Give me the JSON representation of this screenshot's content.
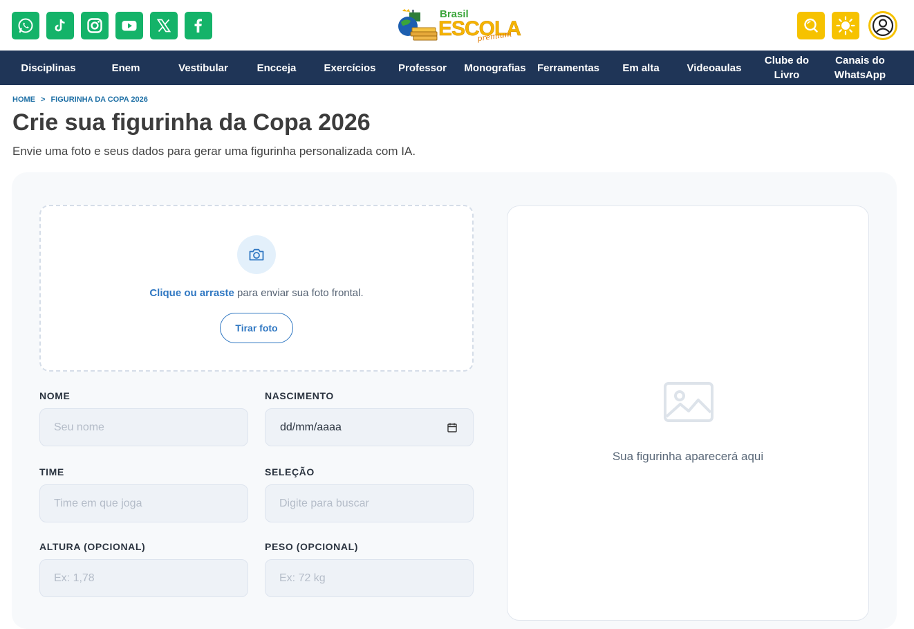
{
  "header": {
    "social_icons": [
      "whatsapp-icon",
      "tiktok-icon",
      "instagram-icon",
      "youtube-icon",
      "x-icon",
      "facebook-icon"
    ],
    "logo": {
      "brand_top": "Brasil",
      "brand_main": "ESCOLA",
      "brand_tag": "premium"
    },
    "action_icons": [
      "search-icon",
      "theme-toggle-icon",
      "user-icon"
    ],
    "accent_color": "#f6c200",
    "social_color": "#14b369"
  },
  "nav": {
    "items": [
      "Disciplinas",
      "Enem",
      "Vestibular",
      "Encceja",
      "Exercícios",
      "Professor",
      "Monografias",
      "Ferramentas",
      "Em alta",
      "Videoaulas",
      "Clube do Livro",
      "Canais do WhatsApp"
    ],
    "background": "#1f3557"
  },
  "breadcrumb": {
    "home": "HOME",
    "separator": ">",
    "current": "FIGURINHA DA COPA 2026"
  },
  "page": {
    "title": "Crie sua figurinha da Copa 2026",
    "subtitle": "Envie uma foto e seus dados para gerar uma figurinha personalizada com IA."
  },
  "upload": {
    "icon": "camera-icon",
    "link_text": "Clique ou arraste",
    "rest_text": " para enviar sua foto frontal.",
    "photo_button": "Tirar foto"
  },
  "form": {
    "nome": {
      "label": "NOME",
      "placeholder": "Seu nome"
    },
    "nascimento": {
      "label": "NASCIMENTO",
      "value": "dd/mm/aaaa"
    },
    "time": {
      "label": "TIME",
      "placeholder": "Time em que joga"
    },
    "selecao": {
      "label": "SELEÇÃO",
      "placeholder": "Digite para buscar"
    },
    "altura": {
      "label": "ALTURA (OPCIONAL)",
      "placeholder": "Ex: 1,78"
    },
    "peso": {
      "label": "PESO (OPCIONAL)",
      "placeholder": "Ex: 72 kg"
    }
  },
  "preview": {
    "icon": "image-placeholder-icon",
    "text": "Sua figurinha aparecerá aqui"
  }
}
